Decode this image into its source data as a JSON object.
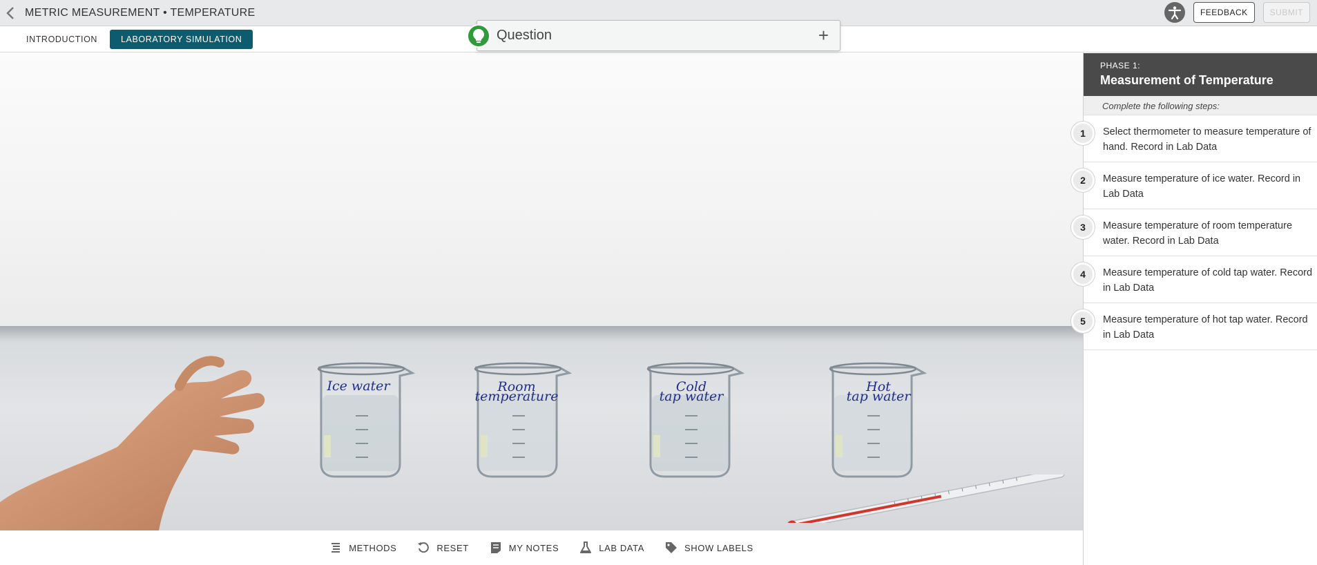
{
  "header": {
    "title": "METRIC MEASUREMENT • TEMPERATURE",
    "feedback_label": "FEEDBACK",
    "submit_label": "SUBMIT"
  },
  "tabs": [
    {
      "label": "INTRODUCTION",
      "active": false
    },
    {
      "label": "LABORATORY SIMULATION",
      "active": true
    }
  ],
  "question": {
    "label": "Question",
    "toggle": "+"
  },
  "scene": {
    "beakers": [
      {
        "label_line1": "Ice water",
        "label_line2": ""
      },
      {
        "label_line1": "Room",
        "label_line2": "temperature"
      },
      {
        "label_line1": "Cold",
        "label_line2": "tap water"
      },
      {
        "label_line1": "Hot",
        "label_line2": "tap water"
      }
    ]
  },
  "sidebar": {
    "phase_label": "PHASE 1:",
    "phase_title": "Measurement of Temperature",
    "instruction": "Complete the following steps:",
    "steps": [
      {
        "num": "1",
        "text": "Select thermometer to measure temperature of hand. Record in Lab Data"
      },
      {
        "num": "2",
        "text": "Measure temperature of ice water. Record in Lab Data"
      },
      {
        "num": "3",
        "text": "Measure temperature of room temperature water. Record in Lab Data"
      },
      {
        "num": "4",
        "text": "Measure temperature of cold tap water. Record in Lab Data"
      },
      {
        "num": "5",
        "text": "Measure temperature of hot tap water. Record in Lab Data"
      }
    ]
  },
  "toolbar": {
    "methods": "METHODS",
    "reset": "RESET",
    "my_notes": "MY NOTES",
    "lab_data": "LAB DATA",
    "show_labels": "SHOW LABELS"
  },
  "colors": {
    "accent": "#0d5b6e",
    "bulb": "#2f9b3a",
    "phase_header": "#4a4a4a"
  }
}
